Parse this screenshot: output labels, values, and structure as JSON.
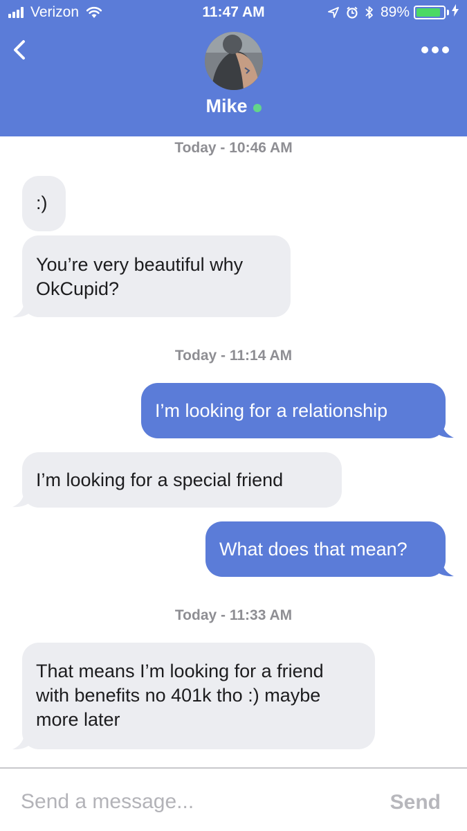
{
  "status_bar": {
    "carrier": "Verizon",
    "time": "11:47 AM",
    "battery_percent": "89%",
    "battery_level": 0.89,
    "icons": [
      "signal-icon",
      "wifi-icon",
      "location-icon",
      "alarm-icon",
      "bluetooth-icon",
      "battery-icon",
      "charging-icon"
    ]
  },
  "header": {
    "back_icon": "chevron-left-icon",
    "more_icon": "more-dots-icon",
    "contact_name": "Mike",
    "online": true
  },
  "messages": [
    {
      "type": "timestamp",
      "text": "Today - 10:46 AM"
    },
    {
      "type": "incoming",
      "text": ":)"
    },
    {
      "type": "incoming",
      "text": "You’re very beautiful why OkCupid?"
    },
    {
      "type": "timestamp",
      "text": "Today - 11:14 AM"
    },
    {
      "type": "outgoing",
      "text": "I’m looking for a relationship"
    },
    {
      "type": "incoming",
      "text": "I’m looking for a special friend"
    },
    {
      "type": "outgoing",
      "text": "What does that mean?"
    },
    {
      "type": "timestamp",
      "text": "Today - 11:33 AM"
    },
    {
      "type": "incoming",
      "text": "That means I’m looking for a friend with benefits no 401k tho :) maybe more later"
    }
  ],
  "composer": {
    "placeholder": "Send a message...",
    "send_label": "Send"
  },
  "colors": {
    "accent": "#5b7cd8",
    "incoming_bubble": "#ecedf1",
    "online": "#63d58a",
    "timestamp": "#8e8e93"
  }
}
